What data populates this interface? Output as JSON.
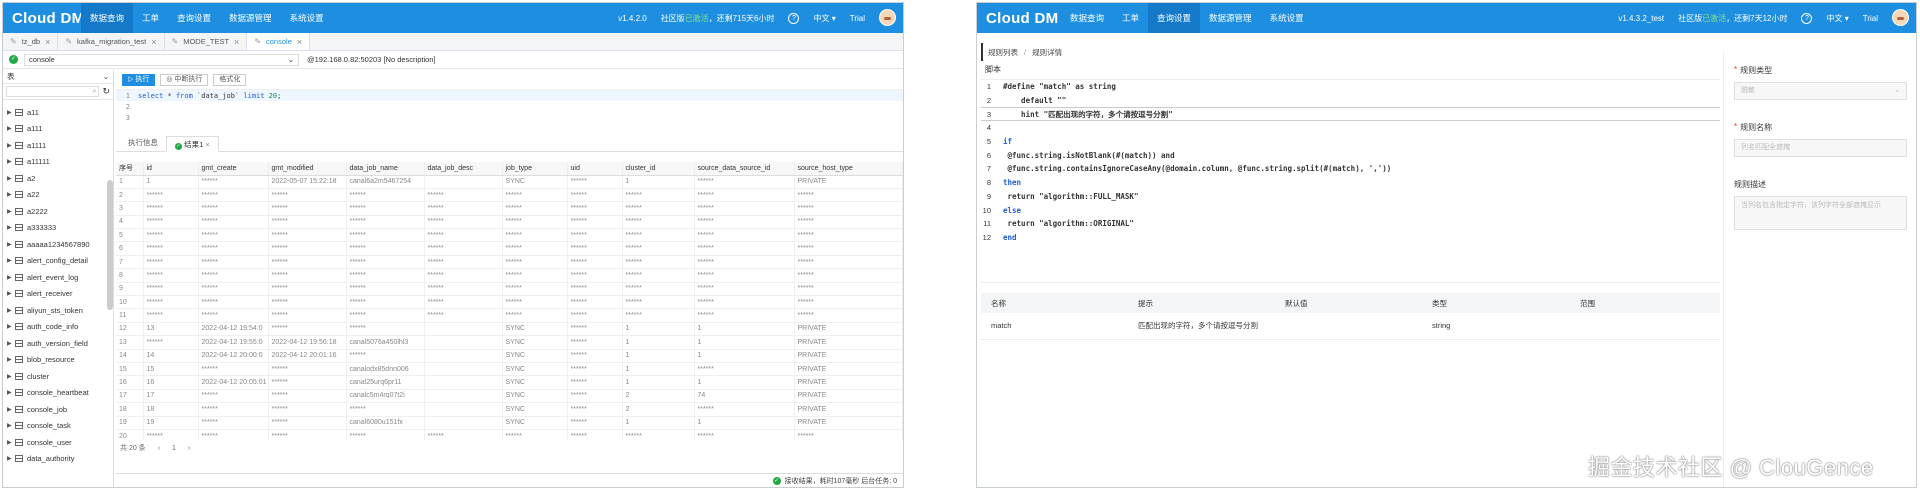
{
  "w1": {
    "logo": "Cloud DM",
    "nav": [
      "数据查询",
      "工单",
      "查询设置",
      "数据源管理",
      "系统设置"
    ],
    "version": "v1.4.2.0",
    "community": "社区版",
    "community_status": "已激活",
    "expiry": "，还剩715天6小时",
    "lang": "中文",
    "user": "Trial",
    "tabs": [
      {
        "label": "tz_db"
      },
      {
        "label": "kafka_migration_test"
      },
      {
        "label": "MODE_TEST"
      },
      {
        "label": "console"
      }
    ],
    "connection": {
      "name": "console",
      "address": "@192.168.0.82:50203",
      "desc": "[No description]"
    },
    "side_select": "表",
    "tables": [
      "a11",
      "a111",
      "a1111",
      "a11111",
      "a2",
      "a22",
      "a2222",
      "a333333",
      "aaaaa1234567890",
      "alert_config_detail",
      "alert_event_log",
      "alert_receiver",
      "aliyun_sts_token",
      "auth_code_info",
      "auth_version_field",
      "blob_resource",
      "cluster",
      "console_heartbeat",
      "console_job",
      "console_task",
      "console_user",
      "data_authority"
    ],
    "toolbar": {
      "run": "执行",
      "stop": "中断执行",
      "format": "格式化"
    },
    "sql": {
      "select": "select",
      "star": " * ",
      "from": "from",
      "table": " `data_job` ",
      "limit": "limit",
      "num": " 20",
      "semi": ";"
    },
    "result_tabs": {
      "info": "执行信息",
      "result": "结果1"
    },
    "columns": [
      "序号",
      "id",
      "gmt_create",
      "gmt_modified",
      "data_job_name",
      "data_job_desc",
      "job_type",
      "uid",
      "cluster_id",
      "source_data_source_id",
      "source_host_type"
    ],
    "rows": [
      [
        "1",
        "1",
        "******",
        "2022-05-07 15:22:18",
        "canal6a2m5467254",
        "",
        "SYNC",
        "******",
        "1",
        "******",
        "PRIVATE"
      ],
      [
        "2",
        "******",
        "******",
        "******",
        "******",
        "******",
        "******",
        "******",
        "******",
        "******",
        "******"
      ],
      [
        "3",
        "******",
        "******",
        "******",
        "******",
        "******",
        "******",
        "******",
        "******",
        "******",
        "******"
      ],
      [
        "4",
        "******",
        "******",
        "******",
        "******",
        "******",
        "******",
        "******",
        "******",
        "******",
        "******"
      ],
      [
        "5",
        "******",
        "******",
        "******",
        "******",
        "******",
        "******",
        "******",
        "******",
        "******",
        "******"
      ],
      [
        "6",
        "******",
        "******",
        "******",
        "******",
        "******",
        "******",
        "******",
        "******",
        "******",
        "******"
      ],
      [
        "7",
        "******",
        "******",
        "******",
        "******",
        "******",
        "******",
        "******",
        "******",
        "******",
        "******"
      ],
      [
        "8",
        "******",
        "******",
        "******",
        "******",
        "******",
        "******",
        "******",
        "******",
        "******",
        "******"
      ],
      [
        "9",
        "******",
        "******",
        "******",
        "******",
        "******",
        "******",
        "******",
        "******",
        "******",
        "******"
      ],
      [
        "10",
        "******",
        "******",
        "******",
        "******",
        "******",
        "******",
        "******",
        "******",
        "******",
        "******"
      ],
      [
        "11",
        "******",
        "******",
        "******",
        "******",
        "******",
        "******",
        "******",
        "******",
        "******",
        "******"
      ],
      [
        "12",
        "13",
        "2022-04-12 19:54:0",
        "******",
        "******",
        "",
        "SYNC",
        "******",
        "1",
        "1",
        "PRIVATE"
      ],
      [
        "13",
        "******",
        "2022-04-12 19:55:0",
        "2022-04-12 19:56:18",
        "canal5076a450lhl3",
        "",
        "SYNC",
        "******",
        "1",
        "1",
        "PRIVATE"
      ],
      [
        "14",
        "14",
        "2022-04-12 20:00:0",
        "2022-04-12 20:01:16",
        "******",
        "",
        "SYNC",
        "******",
        "1",
        "1",
        "PRIVATE"
      ],
      [
        "15",
        "15",
        "******",
        "******",
        "canalodx85dnn006",
        "",
        "SYNC",
        "******",
        "1",
        "******",
        "PRIVATE"
      ],
      [
        "16",
        "16",
        "2022-04-12 20:05:01",
        "******",
        "canal25urq6pr11",
        "",
        "SYNC",
        "******",
        "1",
        "1",
        "PRIVATE"
      ],
      [
        "17",
        "17",
        "******",
        "******",
        "canalc5m4rq07t2i",
        "",
        "SYNC",
        "******",
        "2",
        "74",
        "PRIVATE"
      ],
      [
        "18",
        "18",
        "******",
        "******",
        "******",
        "",
        "SYNC",
        "******",
        "2",
        "******",
        "PRIVATE"
      ],
      [
        "19",
        "19",
        "******",
        "******",
        "canal6080u151fx",
        "",
        "SYNC",
        "******",
        "1",
        "1",
        "PRIVATE"
      ],
      [
        "20",
        "******",
        "******",
        "******",
        "******",
        "******",
        "******",
        "******",
        "******",
        "******",
        "******"
      ]
    ],
    "pager": {
      "total": "共 20 条",
      "page": "1"
    },
    "status": "接收结果，耗时107毫秒  后台任务: 0"
  },
  "w2": {
    "logo": "Cloud DM",
    "nav": [
      "数据查询",
      "工单",
      "查询设置",
      "数据源管理",
      "系统设置"
    ],
    "version": "v1.4.3.2_test",
    "community": "社区版",
    "community_status": "已激活",
    "expiry": "，还剩7天12小时",
    "lang": "中文",
    "user": "Trial",
    "breadcrumb": {
      "list": "规则列表",
      "detail": "规则详情"
    },
    "script_label": "脚本",
    "code": [
      {
        "ln": "1",
        "text": "#define \"match\" as string"
      },
      {
        "ln": "2",
        "text": "    default \"\""
      },
      {
        "ln": "3",
        "text": "    hint \"匹配出现的字符，多个请按逗号分割\""
      },
      {
        "ln": "4",
        "text": ""
      },
      {
        "ln": "5",
        "text": "if"
      },
      {
        "ln": "6",
        "text": " @func.string.isNotBlank(#(match)) and"
      },
      {
        "ln": "7",
        "text": " @func.string.containsIgnoreCaseAny(@domain.column, @func.string.split(#(match), ','))"
      },
      {
        "ln": "8",
        "text": "then"
      },
      {
        "ln": "9",
        "text": " return \"algorithm::FULL_MASK\""
      },
      {
        "ln": "10",
        "text": "else"
      },
      {
        "ln": "11",
        "text": " return \"algorithm::ORIGINAL\""
      },
      {
        "ln": "12",
        "text": "end"
      }
    ],
    "params_columns": [
      "名称",
      "提示",
      "默认值",
      "类型",
      "范围"
    ],
    "params_rows": [
      [
        "match",
        "匹配出现的字符，多个请按逗号分割",
        "",
        "string",
        ""
      ]
    ],
    "form": {
      "type_label": "规则类型",
      "type_value": "脱敏",
      "name_label": "规则名称",
      "name_value": "列名匹配全遮掩",
      "desc_label": "规则描述",
      "desc_value": "当列名包含指定字符，该列字符全部遮掩显示"
    }
  },
  "watermark": "掘金技术社区 @ ClouGence"
}
